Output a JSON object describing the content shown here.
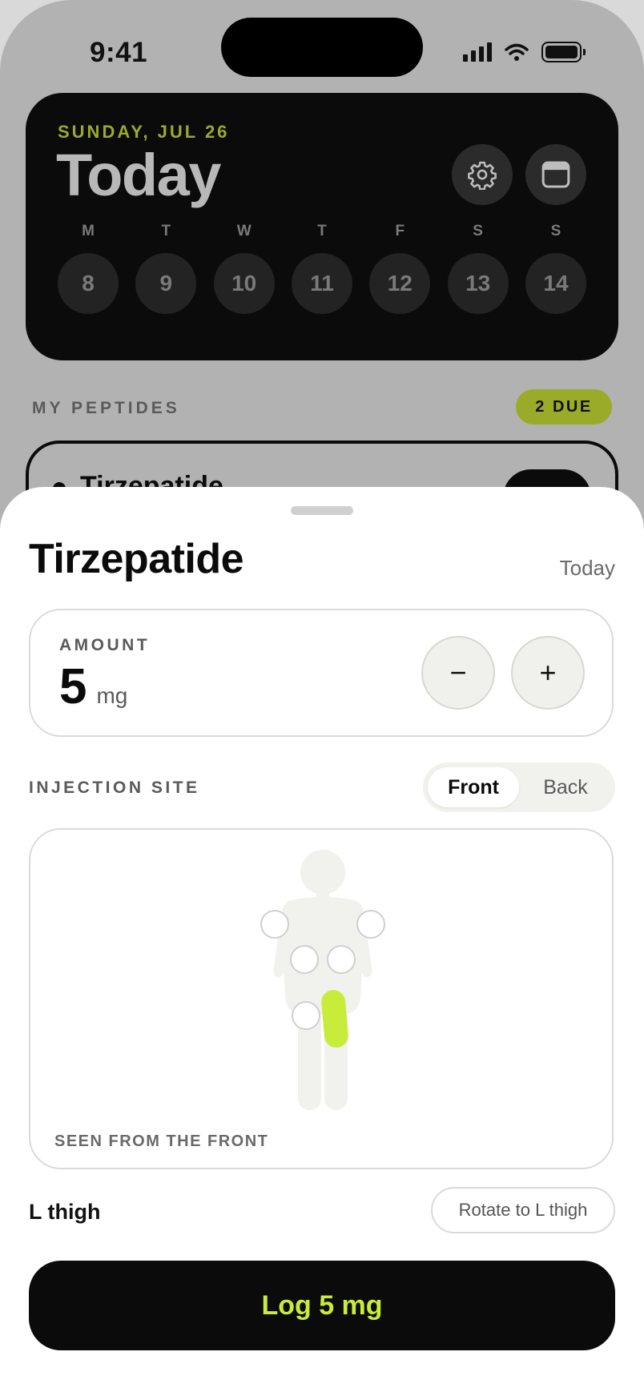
{
  "status_bar": {
    "time": "9:41",
    "icons": [
      "cellular-signal-icon",
      "wifi-icon",
      "battery-icon"
    ]
  },
  "header": {
    "date": "SUNDAY, JUL 26",
    "title": "Today",
    "settings_icon": "gear-icon",
    "calendar_icon": "calendar-icon",
    "week": [
      {
        "label": "M",
        "date": "8"
      },
      {
        "label": "T",
        "date": "9"
      },
      {
        "label": "W",
        "date": "10"
      },
      {
        "label": "T",
        "date": "11"
      },
      {
        "label": "F",
        "date": "12"
      },
      {
        "label": "S",
        "date": "13"
      },
      {
        "label": "S",
        "date": "14"
      }
    ]
  },
  "peptides": {
    "section_label": "MY PEPTIDES",
    "due_badge": "2 DUE",
    "first_item": "Tirzepatide"
  },
  "sheet": {
    "title": "Tirzepatide",
    "date": "Today",
    "amount": {
      "label": "AMOUNT",
      "value": "5",
      "unit": "mg",
      "decrement": "−",
      "increment": "+"
    },
    "injection_site": {
      "label": "INJECTION SITE",
      "view_options": [
        "Front",
        "Back"
      ],
      "selected_view": "Front",
      "caption": "SEEN FROM THE FRONT",
      "site_count": 6,
      "selected_site": "L thigh"
    },
    "rotate_button": "Rotate to L thigh",
    "log_button": "Log 5 mg"
  },
  "colors": {
    "accent_lime": "#c9ec3a",
    "badge_olive": "#9aab2a",
    "dark_card": "#0b0b0b"
  }
}
